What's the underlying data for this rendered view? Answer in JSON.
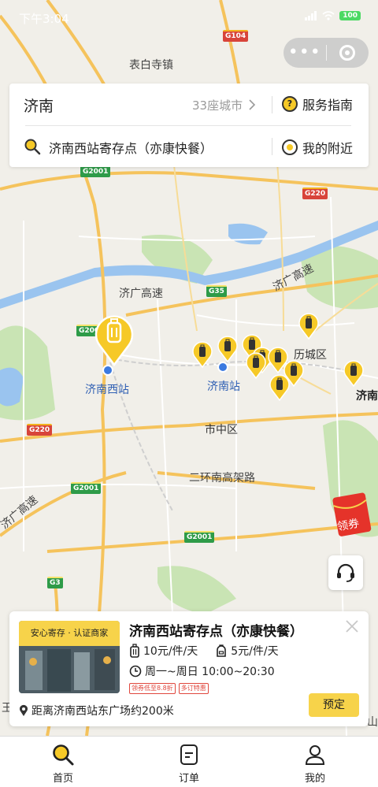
{
  "status_bar": {
    "time": "下午3:04",
    "battery": "100"
  },
  "map": {
    "labels": {
      "town": "表白寺镇",
      "expressway_1": "济广高速",
      "expressway_2": "济广高速",
      "expressway_3": "济广高速",
      "district_licheng": "历城区",
      "district_shizhong": "市中区",
      "ring_road": "二环南高架路",
      "station_west": "济南西站",
      "station_main": "济南站",
      "city_edge": "济南",
      "edge_left": "王",
      "edge_right": "山"
    },
    "shields": [
      "G104",
      "G2001",
      "G220",
      "G35",
      "G2001",
      "G220",
      "G2001",
      "G2001",
      "G3"
    ],
    "pin_icon": "luggage-icon",
    "accent_color": "#f6c927"
  },
  "search": {
    "city": "济南",
    "city_count": "33座城市",
    "guide_label": "服务指南",
    "query": "济南西站寄存点（亦康快餐）",
    "nearby_label": "我的附近"
  },
  "coupon": {
    "label": "领券"
  },
  "store": {
    "badge": "安心寄存 · 认证商家",
    "name": "济南西站寄存点（亦康快餐）",
    "price_large": "10元/件/天",
    "price_small": "5元/件/天",
    "hours": "周一~周日 10:00~20:30",
    "tags": [
      "领券低至8.8折",
      "多订特惠"
    ],
    "distance": "距离济南西站东广场约200米",
    "book_label": "预定"
  },
  "tabs": [
    {
      "label": "首页",
      "icon": "search-icon"
    },
    {
      "label": "订单",
      "icon": "order-icon"
    },
    {
      "label": "我的",
      "icon": "user-icon"
    }
  ]
}
